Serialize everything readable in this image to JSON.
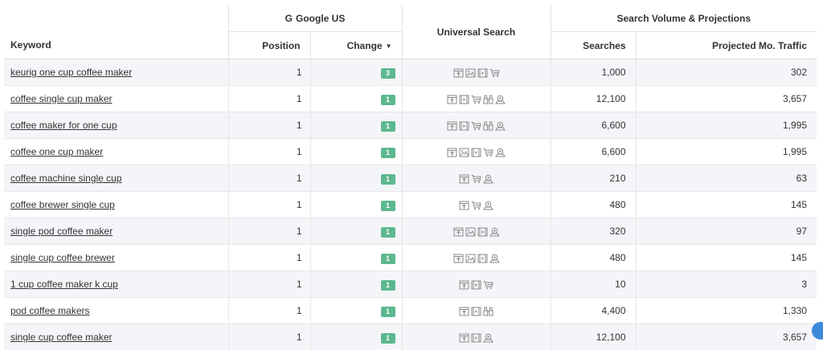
{
  "header": {
    "google_label": "Google US",
    "google_logo": "G",
    "svp_label": "Search Volume & Projections",
    "col_keyword": "Keyword",
    "col_position": "Position",
    "col_change": "Change",
    "col_universal": "Universal Search",
    "col_searches": "Searches",
    "col_traffic": "Projected Mo. Traffic"
  },
  "rows": [
    {
      "keyword": "keurig one cup coffee maker",
      "position": "1",
      "change": "3",
      "icons": [
        "news-icon",
        "image-icon",
        "video-icon",
        "shopping-icon"
      ],
      "searches": "1,000",
      "traffic": "302"
    },
    {
      "keyword": "coffee single cup maker",
      "position": "1",
      "change": "1",
      "icons": [
        "news-icon",
        "video-icon",
        "shopping-icon",
        "binoculars-icon",
        "local-icon"
      ],
      "searches": "12,100",
      "traffic": "3,657"
    },
    {
      "keyword": "coffee maker for one cup",
      "position": "1",
      "change": "1",
      "icons": [
        "news-icon",
        "video-icon",
        "shopping-icon",
        "binoculars-icon",
        "local-icon"
      ],
      "searches": "6,600",
      "traffic": "1,995"
    },
    {
      "keyword": "coffee one cup maker",
      "position": "1",
      "change": "1",
      "icons": [
        "news-icon",
        "image-icon",
        "video-icon",
        "shopping-icon",
        "local-icon"
      ],
      "searches": "6,600",
      "traffic": "1,995"
    },
    {
      "keyword": "coffee machine single cup",
      "position": "1",
      "change": "1",
      "icons": [
        "news-icon",
        "shopping-icon",
        "local-icon"
      ],
      "searches": "210",
      "traffic": "63"
    },
    {
      "keyword": "coffee brewer single cup",
      "position": "1",
      "change": "1",
      "icons": [
        "news-icon",
        "shopping-icon",
        "local-icon"
      ],
      "searches": "480",
      "traffic": "145"
    },
    {
      "keyword": "single pod coffee maker",
      "position": "1",
      "change": "1",
      "icons": [
        "news-icon",
        "image-icon",
        "video-icon",
        "local-icon"
      ],
      "searches": "320",
      "traffic": "97"
    },
    {
      "keyword": "single cup coffee brewer",
      "position": "1",
      "change": "1",
      "icons": [
        "news-icon",
        "image-icon",
        "video-icon",
        "local-icon"
      ],
      "searches": "480",
      "traffic": "145"
    },
    {
      "keyword": "1 cup coffee maker k cup",
      "position": "1",
      "change": "1",
      "icons": [
        "news-icon",
        "video-icon",
        "shopping-icon"
      ],
      "searches": "10",
      "traffic": "3"
    },
    {
      "keyword": "pod coffee makers",
      "position": "1",
      "change": "1",
      "icons": [
        "news-icon",
        "video-icon",
        "binoculars-icon"
      ],
      "searches": "4,400",
      "traffic": "1,330"
    },
    {
      "keyword": "single cup coffee maker",
      "position": "1",
      "change": "1",
      "icons": [
        "news-icon",
        "video-icon",
        "local-icon"
      ],
      "searches": "12,100",
      "traffic": "3,657"
    }
  ],
  "colors": {
    "badge": "#5cb88f",
    "zebra": "#f4f5f8",
    "icon": "#8a8a8a"
  }
}
